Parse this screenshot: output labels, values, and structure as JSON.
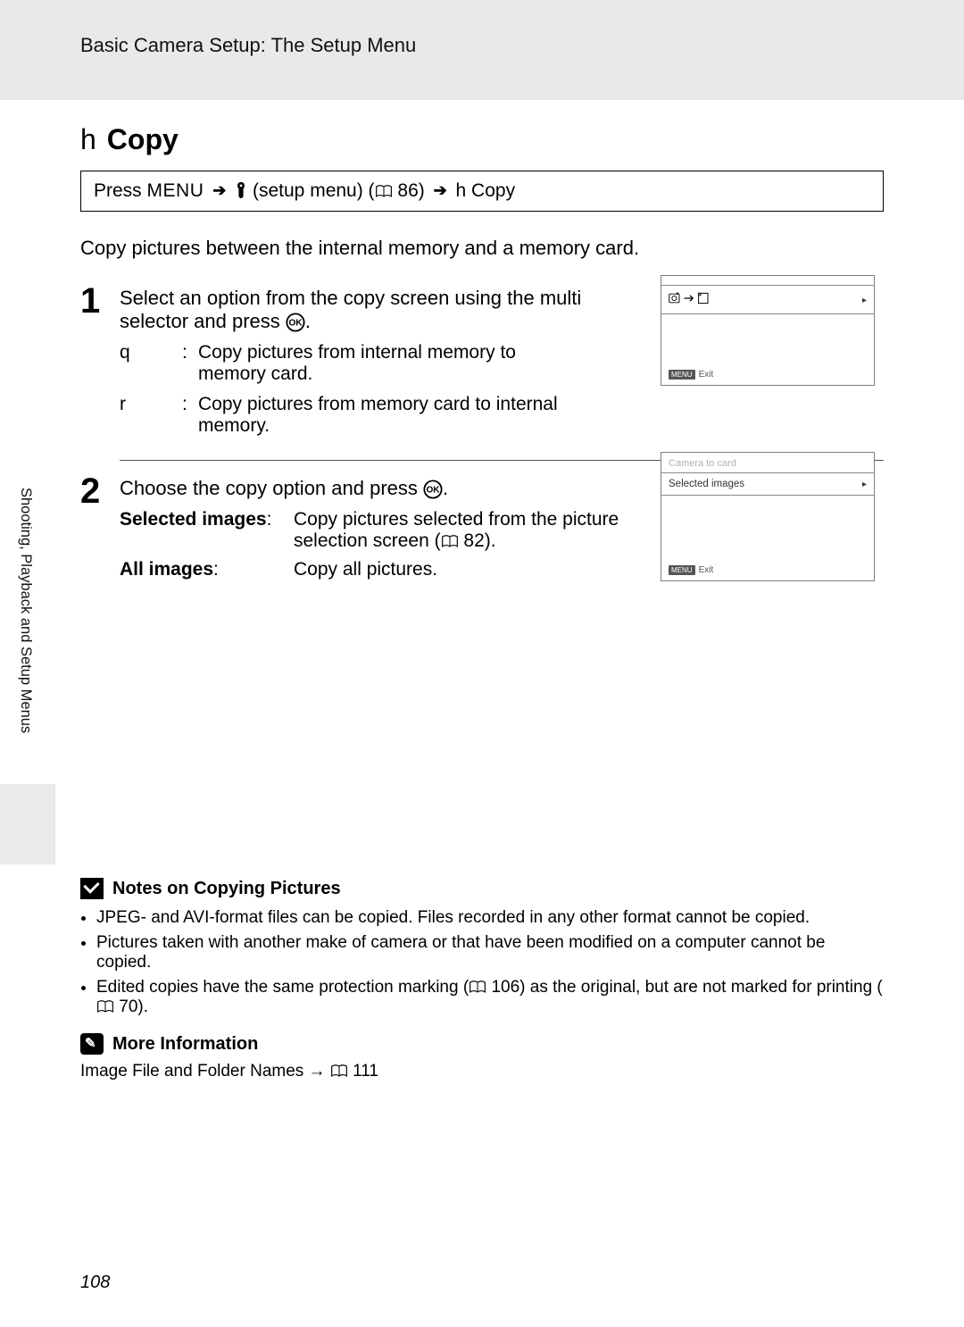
{
  "header": {
    "title": "Basic Camera Setup: The Setup Menu"
  },
  "page_title": {
    "prefix": "h",
    "main": "Copy"
  },
  "nav": {
    "press": "Press",
    "menu_label": "MENU",
    "setup_text": "(setup menu) (",
    "page_ref_1": " 86)",
    "suffix": "h   Copy"
  },
  "intro": "Copy pictures between the internal memory and a memory card.",
  "step1": {
    "num": "1",
    "title_pre": "Select an option from the copy screen using the multi selector and press ",
    "title_post": ".",
    "rows": [
      {
        "letter": "q",
        "text": "Copy pictures from internal memory to memory card."
      },
      {
        "letter": "r",
        "text": "Copy pictures from memory card to internal memory."
      }
    ],
    "screen": {
      "footer_label": "Exit",
      "footer_badge": "MENU"
    }
  },
  "step2": {
    "num": "2",
    "title_pre": "Choose the copy option and press ",
    "title_post": ".",
    "rows": [
      {
        "label": "Selected images",
        "text_pre": "Copy pictures selected from the picture selection screen (",
        "text_ref": " 82).",
        "colon": ":"
      },
      {
        "label": "All images",
        "text": "Copy all pictures.",
        "colon": ":"
      }
    ],
    "screen": {
      "header_small": "Camera to card",
      "row1": "Selected images",
      "footer_label": "Exit",
      "footer_badge": "MENU"
    }
  },
  "sidebar": "Shooting, Playback and Setup Menus",
  "notes": {
    "title": "Notes on Copying Pictures",
    "bullets": [
      "JPEG- and AVI-format files can be copied. Files recorded in any other format cannot be copied.",
      "Pictures taken with another make of camera or that have been modified on a computer cannot be copied."
    ],
    "bullet3_pre": "Edited copies have the same protection marking (",
    "bullet3_mid": " 106) as the original, but are not marked for printing (",
    "bullet3_post": " 70)."
  },
  "more_info": {
    "title": "More Information",
    "text_pre": "Image File and Folder Names → ",
    "text_post": " 111"
  },
  "page_number": "108"
}
